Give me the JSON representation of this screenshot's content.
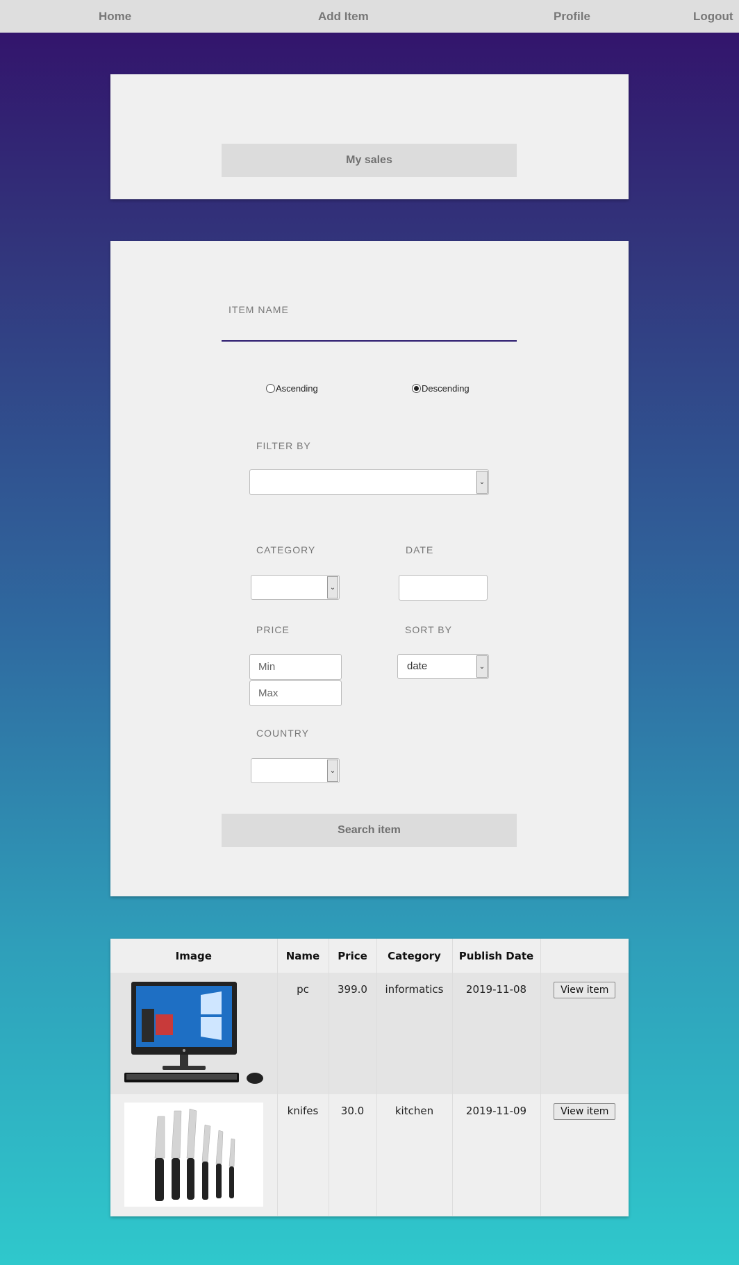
{
  "nav": {
    "home": "Home",
    "add_item": "Add Item",
    "profile": "Profile",
    "logout": "Logout"
  },
  "sales_card": {
    "my_sales_button": "My sales"
  },
  "search": {
    "item_name_label": "ITEM NAME",
    "item_name_value": "",
    "order": {
      "ascending": "Ascending",
      "descending": "Descending",
      "selected": "Descending"
    },
    "filter_by_label": "FILTER BY",
    "filter_by_value": "",
    "category_label": "CATEGORY",
    "category_value": "",
    "date_label": "DATE",
    "date_value": "",
    "price_label": "PRICE",
    "price_min_placeholder": "Min",
    "price_max_placeholder": "Max",
    "sort_by_label": "SORT BY",
    "sort_by_value": "date",
    "country_label": "COUNTRY",
    "country_value": "",
    "search_button": "Search item"
  },
  "table": {
    "headers": [
      "Image",
      "Name",
      "Price",
      "Category",
      "Publish Date",
      ""
    ],
    "rows": [
      {
        "image": "desktop-computer-image",
        "name": "pc",
        "price": "399.0",
        "category": "informatics",
        "date": "2019-11-08",
        "action": "View item"
      },
      {
        "image": "knife-set-image",
        "name": "knifes",
        "price": "30.0",
        "category": "kitchen",
        "date": "2019-11-09",
        "action": "View item"
      }
    ]
  }
}
